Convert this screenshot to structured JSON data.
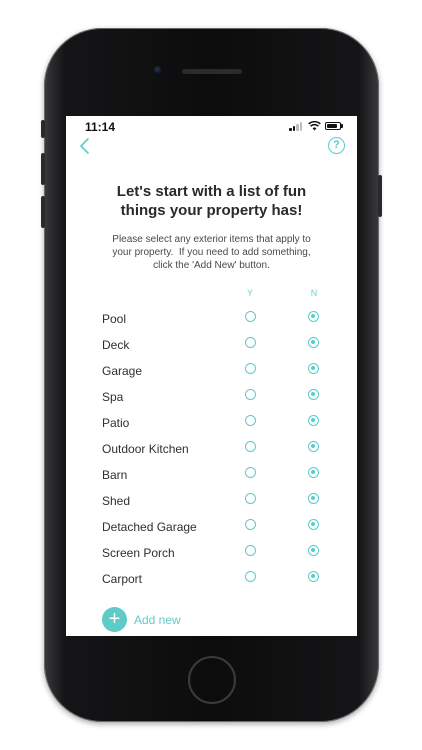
{
  "status_bar": {
    "time": "11:14",
    "icons": [
      "signal-icon",
      "wifi-icon",
      "battery-icon"
    ]
  },
  "nav": {
    "back_icon": "chevron-left-icon",
    "help_icon": "question-circle-icon",
    "help_glyph": "?"
  },
  "title": {
    "line1": "Let's start with a list of fun",
    "line2": "things your property has!"
  },
  "subtitle": {
    "line1": "Please select any exterior items that apply to",
    "line2": "your property.  If you need to add something,",
    "line3": "click the 'Add New' button."
  },
  "columns": {
    "yes": "Y",
    "no": "N"
  },
  "items": [
    {
      "label": "Pool",
      "selected": "N"
    },
    {
      "label": "Deck",
      "selected": "N"
    },
    {
      "label": "Garage",
      "selected": "N"
    },
    {
      "label": "Spa",
      "selected": "N"
    },
    {
      "label": "Patio",
      "selected": "N"
    },
    {
      "label": "Outdoor Kitchen",
      "selected": "N"
    },
    {
      "label": "Barn",
      "selected": "N"
    },
    {
      "label": "Shed",
      "selected": "N"
    },
    {
      "label": "Detached Garage",
      "selected": "N"
    },
    {
      "label": "Screen Porch",
      "selected": "N"
    },
    {
      "label": "Carport",
      "selected": "N"
    }
  ],
  "add_new": {
    "glyph": "+",
    "label": "Add new"
  },
  "colors": {
    "accent": "#5ecbc9",
    "text": "#2f2f2f",
    "phone_body": "#0c0c0d"
  }
}
